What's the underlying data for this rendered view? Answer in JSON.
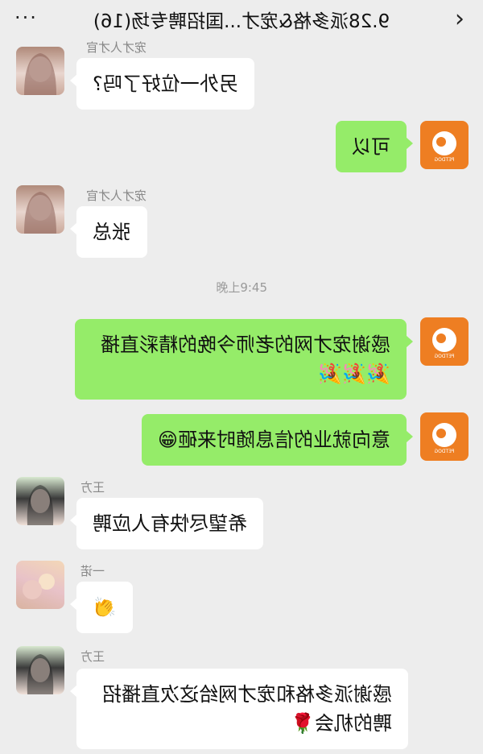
{
  "header": {
    "title": "9.28派多格&宠才...国招聘专场(16)",
    "back_icon": "chevron-left",
    "more_icon": "more-dots"
  },
  "messages": [
    {
      "sender": "",
      "text": "另外一位好了吗?",
      "side": "other",
      "avatar": "girl"
    },
    {
      "sender": "",
      "text": "可以",
      "side": "self",
      "avatar": "brand"
    },
    {
      "sender": "宠才人才官",
      "text": "张总",
      "side": "other",
      "avatar": "girl"
    },
    {
      "time": "晚上9:45"
    },
    {
      "sender": "",
      "text": "感谢宠才网的老师今晚的精彩直播",
      "emoji": "🎉🎉🎉",
      "side": "self",
      "avatar": "brand"
    },
    {
      "sender": "",
      "text": "意向就业的信息随时来砸",
      "emoji": "😁",
      "side": "self",
      "avatar": "brand"
    },
    {
      "sender": "王方",
      "text": "希望尽快有人应聘",
      "side": "other",
      "avatar": "girl2"
    },
    {
      "sender": "一诺",
      "text": "",
      "emoji": "👏",
      "side": "other",
      "avatar": "hands"
    },
    {
      "sender": "王方",
      "text": "感谢派多格和宠才网给这次直播招聘的机会",
      "emoji": "🌹",
      "side": "other",
      "avatar": "girl2"
    }
  ],
  "brand_logo_text": "PETDOG 派多格",
  "colors": {
    "green_bubble": "#95ec69",
    "white_bubble": "#ffffff",
    "brand_orange": "#ee7e22",
    "background": "#ededed"
  }
}
